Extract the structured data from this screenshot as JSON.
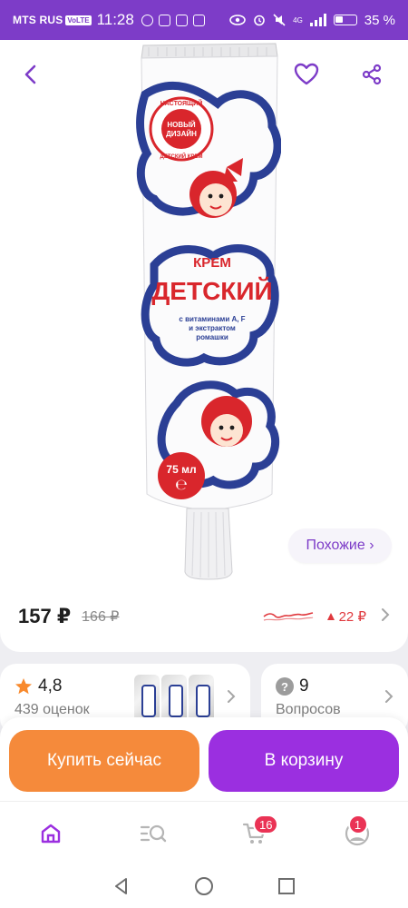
{
  "status_bar": {
    "carrier": "MTS RUS",
    "network_badge": "VoLTE",
    "time": "11:28",
    "battery_percent": "35 %",
    "signal": "4G"
  },
  "product": {
    "similar_label": "Похожие ›",
    "tube_texts": {
      "badge_line1": "НАСТОЯЩИЙ",
      "badge_line2": "НОВЫЙ",
      "badge_line3": "ДИЗАЙН",
      "badge_line4": "ДЕТСКИЙ КРЕМ",
      "krem": "КРЕМ",
      "name": "ДЕТСКИЙ",
      "desc1": "с витаминами А, F",
      "desc2": "и экстрактом",
      "desc3": "ромашки",
      "volume": "75 мл",
      "e_mark": "℮"
    }
  },
  "price": {
    "current": "157 ₽",
    "old": "166 ₽",
    "change": "22 ₽",
    "change_direction": "up"
  },
  "rating_card": {
    "value": "4,8",
    "count_label": "439 оценок"
  },
  "qa_card": {
    "value": "9",
    "label": "Вопросов"
  },
  "actions": {
    "buy_now": "Купить сейчас",
    "add_to_cart": "В корзину"
  },
  "bottom_nav": {
    "cart_badge": "16",
    "profile_badge": "1"
  },
  "colors": {
    "status_bar": "#7d3cc8",
    "accent_purple": "#9b2fe0",
    "buy_orange": "#f58a3b",
    "price_up_red": "#e0393e",
    "badge_red": "#ea3355"
  },
  "icons": [
    "back-arrow-icon",
    "heart-icon",
    "share-icon",
    "star-icon",
    "question-icon",
    "home-icon",
    "catalog-search-icon",
    "cart-icon",
    "profile-icon"
  ]
}
